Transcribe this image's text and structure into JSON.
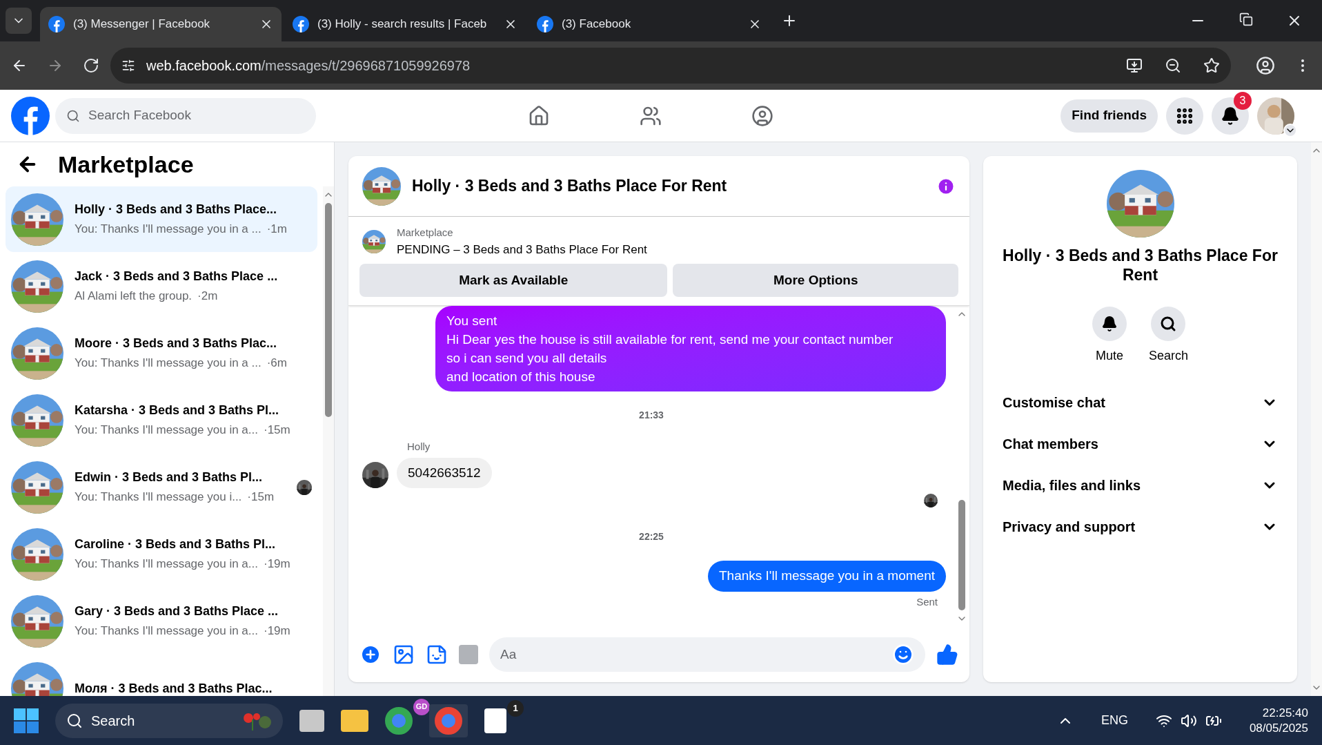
{
  "browser": {
    "tabs": [
      {
        "title": "(3) Messenger | Facebook",
        "selected": true
      },
      {
        "title": "(3) Holly - search results | Faceb",
        "selected": false
      },
      {
        "title": "(3) Facebook",
        "selected": false
      }
    ],
    "url_host": "web.facebook.com",
    "url_path": "/messages/t/29696871059926978"
  },
  "header": {
    "search_placeholder": "Search Facebook",
    "find_friends": "Find friends",
    "notification_count": "3"
  },
  "sidebar": {
    "title": "Marketplace",
    "conversations": [
      {
        "title": "Holly · 3 Beds and 3 Baths Place...",
        "preview": "You: Thanks I'll message you in a ...",
        "time": "·1m",
        "selected": true,
        "seen": false
      },
      {
        "title": "Jack · 3 Beds and 3 Baths Place ...",
        "preview": "Al Alami left the group.",
        "time": "·2m",
        "selected": false,
        "seen": false
      },
      {
        "title": "Moore · 3 Beds and 3 Baths Plac...",
        "preview": "You: Thanks I'll message you in a ...",
        "time": "·6m",
        "selected": false,
        "seen": false
      },
      {
        "title": "Katarsha · 3 Beds and 3 Baths Pl...",
        "preview": "You: Thanks I'll message you in a...",
        "time": "·15m",
        "selected": false,
        "seen": false
      },
      {
        "title": "Edwin · 3 Beds and 3 Baths Pl...",
        "preview": "You: Thanks I'll message you i...",
        "time": "·15m",
        "selected": false,
        "seen": true
      },
      {
        "title": "Caroline · 3 Beds and 3 Baths Pl...",
        "preview": "You: Thanks I'll message you in a...",
        "time": "·19m",
        "selected": false,
        "seen": false
      },
      {
        "title": "Gary · 3 Beds and 3 Baths Place ...",
        "preview": "You: Thanks I'll message you in a...",
        "time": "·19m",
        "selected": false,
        "seen": false
      },
      {
        "title": "Моля · 3 Beds and 3 Baths Plac...",
        "selected": false,
        "seen": false
      }
    ]
  },
  "chat": {
    "title": "Holly · 3 Beds and 3 Baths Place For Rent",
    "listing": {
      "label": "Marketplace",
      "title": "PENDING – 3 Beds and 3 Baths Place For Rent"
    },
    "buttons": [
      "Mark as Available",
      "More Options"
    ],
    "messages": [
      {
        "kind": "outgoing_highlight",
        "label": "You sent",
        "lines": [
          "Hi Dear yes the house is still available for rent, send me your contact number",
          "so i can send you all details",
          "and location of this house"
        ]
      },
      {
        "kind": "timestamp",
        "text": "21:33"
      },
      {
        "kind": "incoming",
        "sender": "Holly",
        "text": "5042663512"
      },
      {
        "kind": "seen"
      },
      {
        "kind": "timestamp",
        "text": "22:25"
      },
      {
        "kind": "outgoing",
        "text": "Thanks I'll message you in a moment",
        "status": "Sent"
      }
    ],
    "composer_placeholder": "Aa"
  },
  "details": {
    "title": "Holly · 3 Beds and 3 Baths Place For Rent",
    "actions": [
      {
        "kind": "bell",
        "label": "Mute"
      },
      {
        "kind": "search",
        "label": "Search"
      }
    ],
    "sections": [
      {
        "label": "Customise chat",
        "expanded": false
      },
      {
        "label": "Chat members",
        "expanded": false
      },
      {
        "label": "Media, files and links",
        "expanded": false
      },
      {
        "label": "Privacy and support",
        "expanded": false
      }
    ]
  },
  "taskbar": {
    "search_placeholder": "Search",
    "browser_badge": "GD",
    "notes_badge": "1",
    "language": "ENG",
    "time": "22:25:40",
    "date": "08/05/2025"
  }
}
